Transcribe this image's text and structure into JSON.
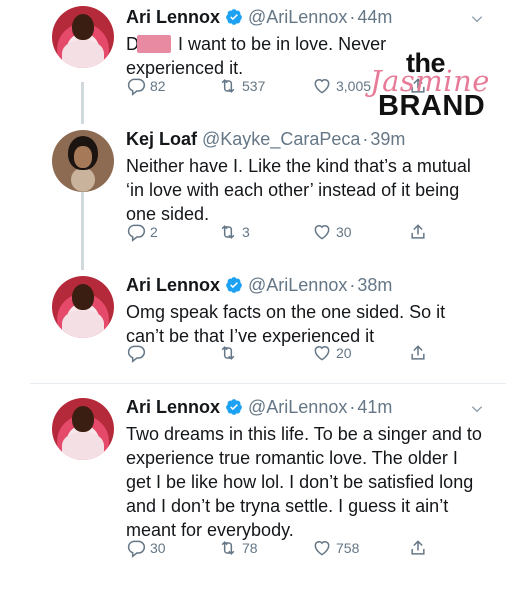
{
  "tweets": [
    {
      "name": "Ari Lennox",
      "handle": "@AriLennox",
      "time": "44m",
      "text_prefix": "D",
      "text": "I want to be in love. Never experienced it.",
      "replies": "82",
      "retweets": "537",
      "likes": "3,005"
    },
    {
      "name": "Kej Loaf",
      "handle": "@Kayke_CaraPeca",
      "time": "39m",
      "text": "Neither have I. Like the kind that’s a mutual ‘in love with each other’ instead of it being one sided.",
      "replies": "2",
      "retweets": "3",
      "likes": "30"
    },
    {
      "name": "Ari Lennox",
      "handle": "@AriLennox",
      "time": "38m",
      "text": "Omg speak facts on the one sided. So it can’t be that I’ve experienced it",
      "replies": "",
      "retweets": "",
      "likes": "20"
    },
    {
      "name": "Ari Lennox",
      "handle": "@AriLennox",
      "time": "41m",
      "text": "Two dreams in this life. To be a singer and to experience true romantic love. The older I get I be like how lol. I don’t be satisfied long and I don’t be tryna settle. I guess it ain’t meant for everybody.",
      "replies": "30",
      "retweets": "78",
      "likes": "758"
    }
  ],
  "separator": "·",
  "watermark": {
    "line1": "the",
    "line2": "Jasmine",
    "line3": "BRAND"
  },
  "icons": [
    "verified-badge-icon",
    "chevron-down-icon",
    "reply-icon",
    "retweet-icon",
    "like-icon",
    "share-icon"
  ],
  "colors": {
    "verified": "#1da1f2",
    "meta": "#657786",
    "text": "#14171a",
    "watermark_pink": "#e77c98"
  }
}
